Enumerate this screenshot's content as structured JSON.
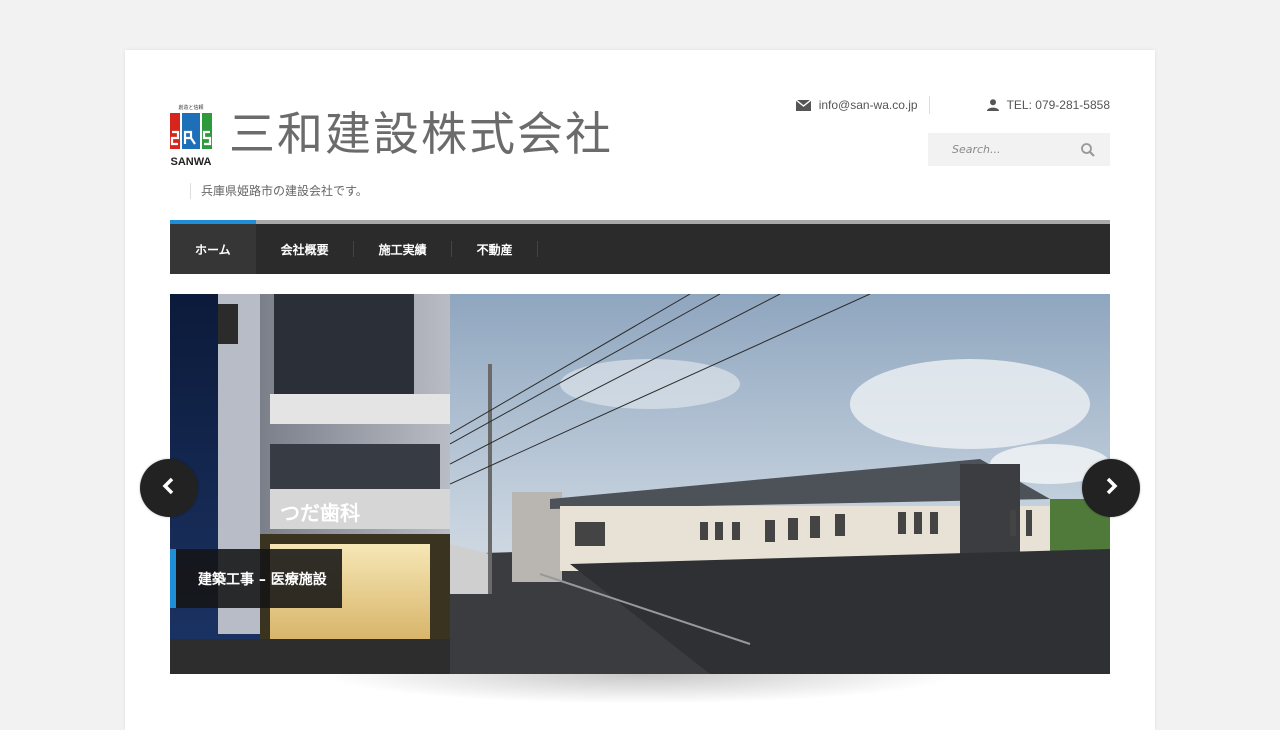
{
  "brand": {
    "company_name": "三和建設株式会社",
    "logo_small_text": "SANWA",
    "logo_top_text": "創造と信頼の三和建設",
    "tagline": "兵庫県姫路市の建設会社です。"
  },
  "contacts": {
    "email": "info@san-wa.co.jp",
    "phone": "TEL: 079-281-5858"
  },
  "search": {
    "placeholder": "Search..."
  },
  "nav": {
    "items": [
      {
        "label": "ホーム",
        "active": true
      },
      {
        "label": "会社概要"
      },
      {
        "label": "施工実績"
      },
      {
        "label": "不動産"
      }
    ]
  },
  "slider": {
    "caption": "建築工事 – 医療施設",
    "left_sign_top": "つだ",
    "left_sign_main": "つだ歯科"
  },
  "colors": {
    "accent": "#1e8fd6",
    "nav_bg": "#2b2b2b",
    "logo_red": "#d7251d",
    "logo_blue": "#1d6fb8",
    "logo_green": "#2f9a3b"
  },
  "icons": {
    "email": "envelope-icon",
    "phone": "user-icon",
    "search": "magnifier-icon",
    "prev": "chevron-left-icon",
    "next": "chevron-right-icon"
  }
}
